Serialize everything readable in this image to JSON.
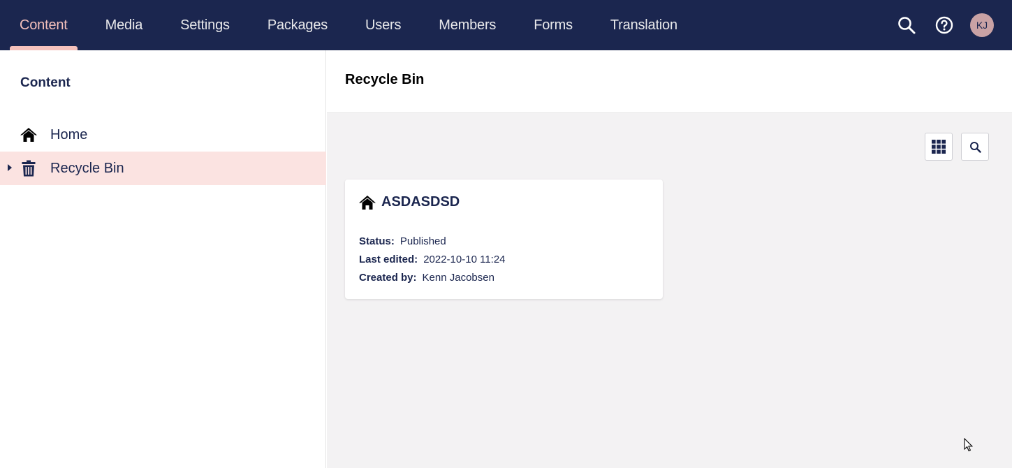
{
  "topbar": {
    "sections": [
      {
        "label": "Content",
        "active": true
      },
      {
        "label": "Media"
      },
      {
        "label": "Settings"
      },
      {
        "label": "Packages"
      },
      {
        "label": "Users"
      },
      {
        "label": "Members"
      },
      {
        "label": "Forms"
      },
      {
        "label": "Translation"
      }
    ],
    "icons": [
      "search-icon",
      "help-icon"
    ],
    "user_initials": "KJ"
  },
  "sidebar": {
    "title": "Content",
    "tree": [
      {
        "label": "Home",
        "icon": "home-icon",
        "selected": false
      },
      {
        "label": "Recycle Bin",
        "icon": "trash-icon",
        "selected": true,
        "has_children": true
      }
    ]
  },
  "main": {
    "title": "Recycle Bin",
    "toolbar": {
      "layout_icon": "grid-icon",
      "search_icon": "search-icon"
    },
    "card": {
      "icon": "home-icon",
      "name": "ASDASDSD",
      "status_key": "Status:",
      "status_value": "Published",
      "last_edited_key": "Last edited:",
      "last_edited_value": "2022-10-10 11:24",
      "created_by_key": "Created by:",
      "created_by_value": "Kenn Jacobsen"
    }
  },
  "colors": {
    "topbar_bg": "#1b264f",
    "accent": "#f5c1bc",
    "selected_bg": "#fbe3e1",
    "main_bg": "#f3f2f3"
  }
}
